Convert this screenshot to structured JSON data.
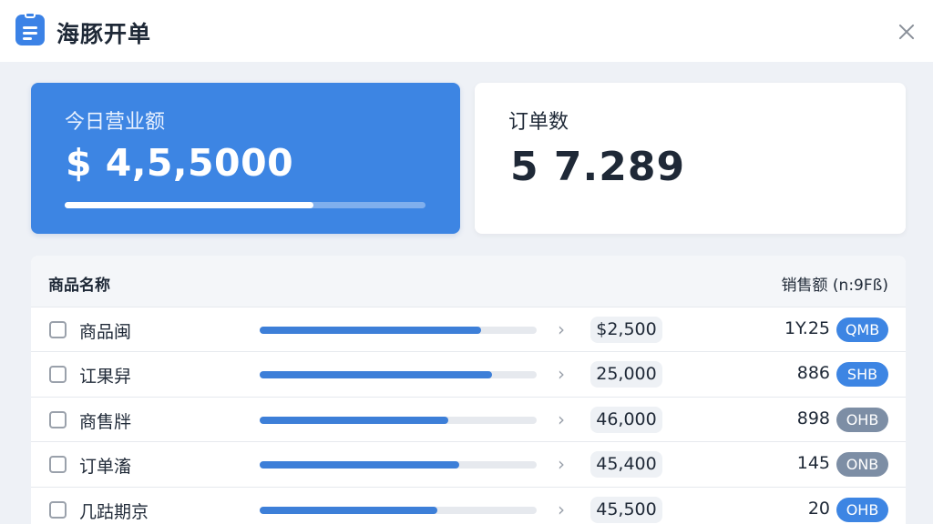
{
  "window": {
    "title": "海豚开单",
    "close_icon": "close-icon",
    "app_icon": "clipboard-icon"
  },
  "stats": {
    "revenue": {
      "label": "今日营业额",
      "value": "$ 4,5,5000",
      "progress": 0.69
    },
    "orders": {
      "label": "订单数",
      "value": "5 7.289"
    }
  },
  "table": {
    "headers": {
      "name": "商品名称",
      "sales": "销售额 (n:9Fß)"
    },
    "rows": [
      {
        "name": "商品闽",
        "progress": 0.8,
        "amount": "$2,500",
        "sales": "1Y.25",
        "tag": "QMB",
        "tag_color": "#3d85e3"
      },
      {
        "name": "讧果舁",
        "progress": 0.84,
        "amount": "25,000",
        "sales": "886",
        "tag": "SHB",
        "tag_color": "#3d85e3"
      },
      {
        "name": "商售牉",
        "progress": 0.68,
        "amount": "46,000",
        "sales": "898",
        "tag": "OHB",
        "tag_color": "#7d8ea5"
      },
      {
        "name": "订单滀",
        "progress": 0.72,
        "amount": "45,400",
        "sales": "145",
        "tag": "ONB",
        "tag_color": "#7d8ea5"
      },
      {
        "name": "几跍期京",
        "progress": 0.64,
        "amount": "45,500",
        "sales": "20",
        "tag": "OHB",
        "tag_color": "#3d85e3"
      }
    ]
  }
}
